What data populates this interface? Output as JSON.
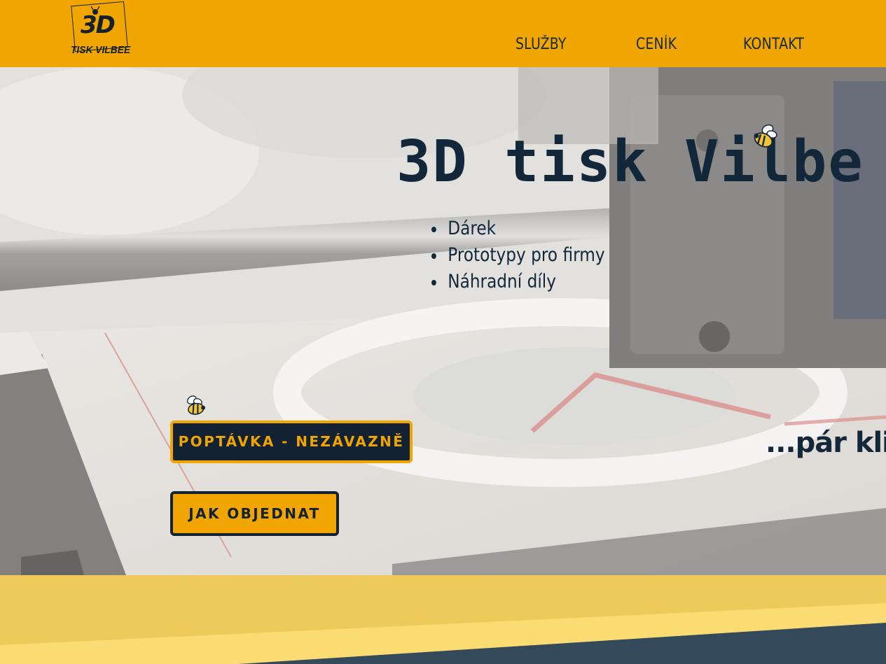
{
  "header": {
    "logo": {
      "big_text": "3D",
      "text": "TISK VILBEE"
    },
    "nav": [
      {
        "label": "SLUŽBY"
      },
      {
        "label": "CENÍK"
      },
      {
        "label": "KONTAKT"
      }
    ]
  },
  "hero": {
    "title": "3D tisk Vilbe",
    "bullets": [
      "Dárek",
      "Prototypy pro firmy",
      "Náhradní díly"
    ],
    "primary_button": "POPTÁVKA - NEZÁVAZNĚ",
    "secondary_button": "JAK OBJEDNAT",
    "tagline": "...pár klik"
  },
  "colors": {
    "accent": "#f0a500",
    "dark": "#132232",
    "band_yellow": "#f6d25e",
    "band_dark": "#34495a"
  },
  "icons": [
    "bee-icon",
    "ant-logo-icon"
  ]
}
